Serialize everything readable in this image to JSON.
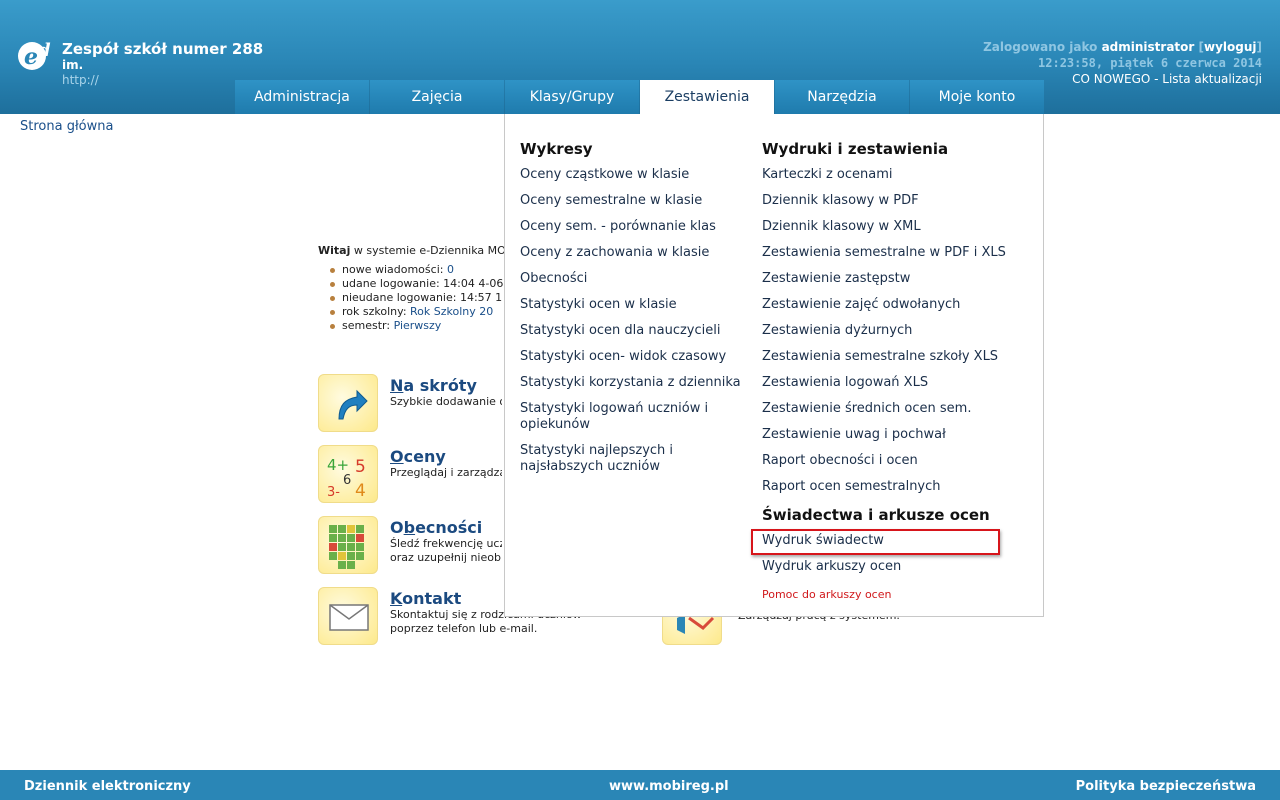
{
  "header": {
    "logo_icon": "e-dziennik-logo",
    "school_name": "Zespół szkół numer 288",
    "school_im": "im.",
    "school_url": "http://",
    "login_prefix": "Zalogowano jako",
    "login_user": "administrator",
    "logout_label": "wyloguj",
    "datetime": "12:23:58, piątek 6 czerwca 2014",
    "whatsnew": "CO NOWEGO - Lista aktualizacji"
  },
  "tabs": [
    {
      "label": "Administracja"
    },
    {
      "label": "Zajęcia"
    },
    {
      "label": "Klasy/Grupy"
    },
    {
      "label": "Zestawienia"
    },
    {
      "label": "Narzędzia"
    },
    {
      "label": "Moje konto"
    }
  ],
  "breadcrumb": "Strona główna",
  "welcome": {
    "bold": "Witaj",
    "text": " w systemie e-Dziennika MO",
    "items": [
      {
        "label": "nowe wiadomości: ",
        "value": "0"
      },
      {
        "label": "udane logowanie: 14:04 4-06",
        "value": ""
      },
      {
        "label": "nieudane logowanie: 14:57 1",
        "value": ""
      },
      {
        "label": "rok szkolny: ",
        "value": "Rok Szkolny 20"
      },
      {
        "label": "semestr: ",
        "value": "Pierwszy"
      }
    ]
  },
  "shortcuts": [
    {
      "title": "Na skróty",
      "desc": "Szybkie dodawanie o",
      "desc2": "",
      "icon": "arrow-icon"
    },
    {
      "title": "Oceny",
      "desc": "Przeglądaj i zarządza",
      "desc2": "",
      "icon": "grades-icon"
    },
    {
      "title": "Obecności",
      "desc": "Śledź frekwencję ucz",
      "desc2": "oraz uzupełnij nieob",
      "icon": "attendance-grid-icon"
    },
    {
      "title": "Kontakt",
      "desc": "Skontaktuj się z rodzicami uczniów",
      "desc2": "poprzez telefon lub e-mail.",
      "icon": "envelope-icon"
    }
  ],
  "shortcut_right": {
    "desc": "Zarządzaj pracą z systemem.",
    "icon": "tools-icon"
  },
  "dropdown": {
    "col1_head": "Wykresy",
    "col1": [
      "Oceny cząstkowe w klasie",
      "Oceny semestralne w klasie",
      "Oceny sem. - porównanie klas",
      "Oceny z zachowania w klasie",
      "Obecności",
      "Statystyki ocen w klasie",
      "Statystyki ocen dla nauczycieli",
      "Statystyki ocen- widok czasowy",
      "Statystyki korzystania z dziennika",
      "Statystyki logowań uczniów i opiekunów",
      "Statystyki najlepszych i najsłabszych uczniów"
    ],
    "col2_head": "Wydruki i zestawienia",
    "col2": [
      "Karteczki z ocenami",
      "Dziennik klasowy w PDF",
      "Dziennik klasowy w XML",
      "Zestawienia semestralne w PDF i XLS",
      "Zestawienie zastępstw",
      "Zestawienie zajęć odwołanych",
      "Zestawienia dyżurnych",
      "Zestawienia semestralne szkoły XLS",
      "Zestawienia logowań XLS",
      "Zestawienie średnich ocen sem.",
      "Zestawienie uwag i pochwał",
      "Raport obecności i ocen",
      "Raport ocen semestralnych"
    ],
    "col3_head": "Świadectwa i arkusze ocen",
    "col3": [
      "Wydruk świadectw",
      "Wydruk arkuszy ocen"
    ],
    "help": "Pomoc do arkuszy ocen"
  },
  "footer": {
    "left": "Dziennik elektroniczny",
    "center": "www.mobireg.pl",
    "right": "Polityka bezpieczeństwa"
  }
}
